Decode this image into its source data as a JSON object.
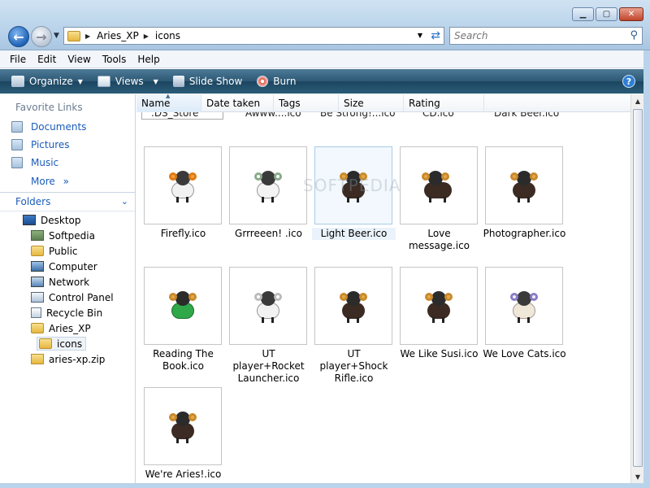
{
  "address": {
    "crumbs": [
      "Aries_XP",
      "icons"
    ]
  },
  "search": {
    "placeholder": "Search"
  },
  "menu": [
    "File",
    "Edit",
    "View",
    "Tools",
    "Help"
  ],
  "toolbar": {
    "organize": "Organize",
    "views": "Views",
    "slideshow": "Slide Show",
    "burn": "Burn"
  },
  "favorites": {
    "title": "Favorite Links",
    "links": [
      "Documents",
      "Pictures",
      "Music"
    ],
    "more": "More"
  },
  "folders": {
    "title": "Folders",
    "tree": [
      "Desktop",
      "Softpedia",
      "Public",
      "Computer",
      "Network",
      "Control Panel",
      "Recycle Bin",
      "Aries_XP",
      "icons",
      "aries-xp.zip"
    ]
  },
  "columns": [
    "Name",
    "Date taken",
    "Tags",
    "Size",
    "Rating"
  ],
  "partial_row": [
    ".DS_Store",
    "Awww....ico",
    "Be Strong!...ico",
    "CD.ico",
    "Dark Beer.ico"
  ],
  "files": [
    [
      "Firefly.ico"
    ],
    [
      "Grrreeen! .ico"
    ],
    [
      "Light Beer.ico"
    ],
    [
      "Love message.ico"
    ],
    [
      "Photographer.ico"
    ],
    [
      "Reading The",
      "Book.ico"
    ],
    [
      "UT player+Rocket",
      "Launcher.ico"
    ],
    [
      "UT player+Shock",
      "Rifle.ico"
    ],
    [
      "We Like Susi.ico"
    ],
    [
      "We Love Cats.ico"
    ],
    [
      "We're Aries!.ico"
    ]
  ],
  "watermark": "SOFTPEDIA",
  "colors": {
    "accent": "#1a5bb8",
    "toolbar": "#2c5874",
    "selection": "#eaf3fb"
  },
  "icons": {
    "window": [
      "minimize-icon",
      "maximize-icon",
      "close-icon"
    ],
    "nav": [
      "back-arrow-icon",
      "forward-arrow-icon"
    ]
  }
}
